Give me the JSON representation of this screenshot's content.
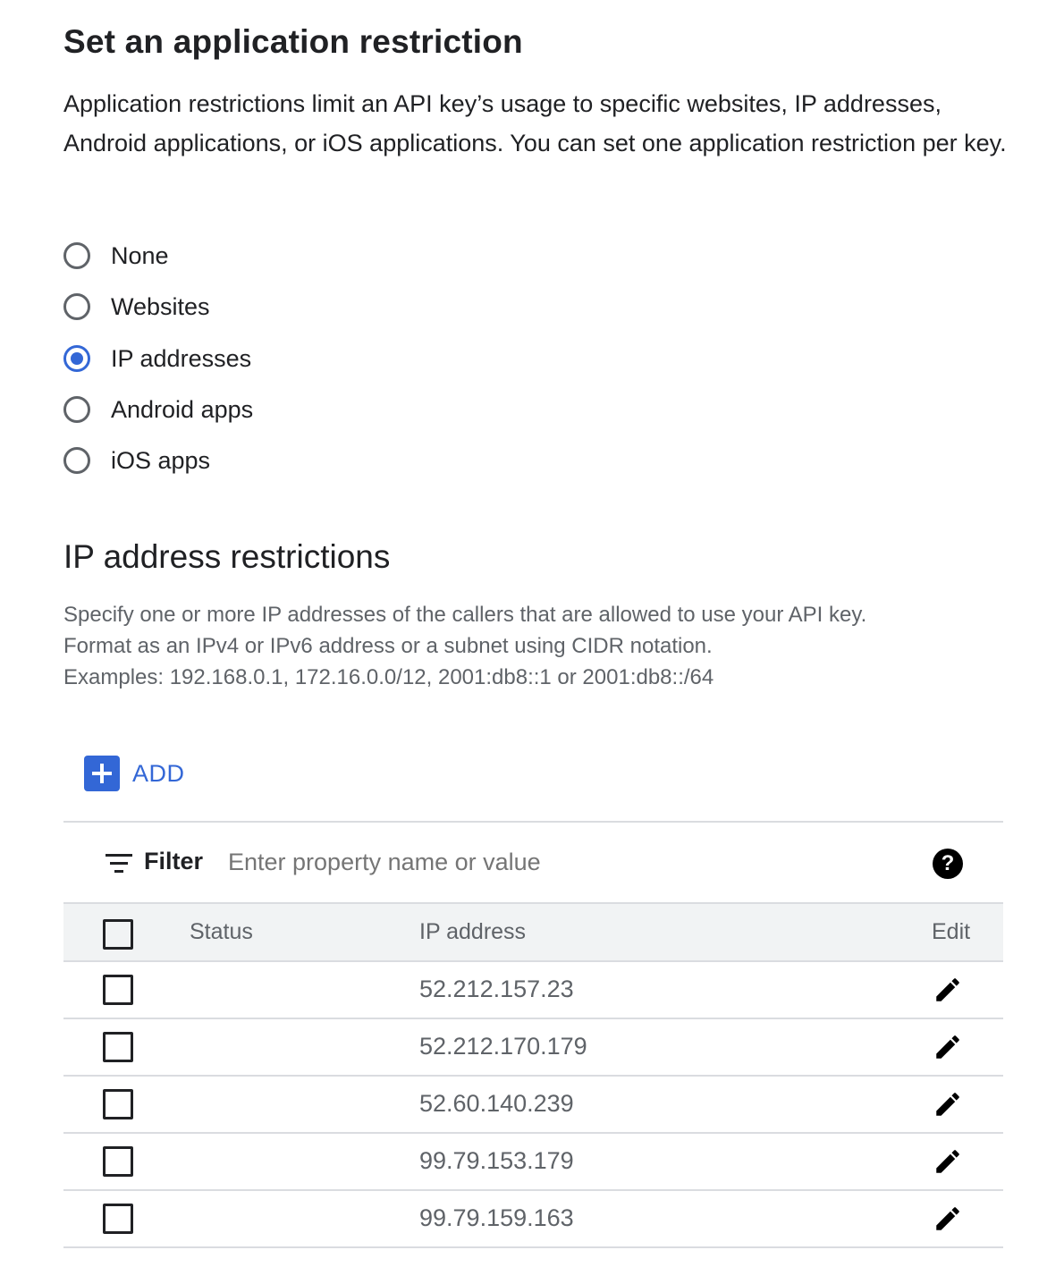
{
  "restriction": {
    "title": "Set an application restriction",
    "description": "Application restrictions limit an API key’s usage to specific websites, IP addresses, Android applications, or iOS applications. You can set one application restriction per key.",
    "options": [
      {
        "label": "None",
        "selected": false
      },
      {
        "label": "Websites",
        "selected": false
      },
      {
        "label": "IP addresses",
        "selected": true
      },
      {
        "label": "Android apps",
        "selected": false
      },
      {
        "label": "iOS apps",
        "selected": false
      }
    ]
  },
  "ip_restrictions": {
    "title": "IP address restrictions",
    "help_lines": [
      "Specify one or more IP addresses of the callers that are allowed to use your API key.",
      "Format as an IPv4 or IPv6 address or a subnet using CIDR notation.",
      "Examples: 192.168.0.1, 172.16.0.0/12, 2001:db8::1 or 2001:db8::/64"
    ],
    "add_label": "ADD",
    "filter": {
      "label": "Filter",
      "placeholder": "Enter property name or value",
      "help_glyph": "?"
    },
    "columns": {
      "status": "Status",
      "ip": "IP address",
      "edit": "Edit"
    },
    "rows": [
      {
        "status": "",
        "ip": "52.212.157.23"
      },
      {
        "status": "",
        "ip": "52.212.170.179"
      },
      {
        "status": "",
        "ip": "52.60.140.239"
      },
      {
        "status": "",
        "ip": "99.79.153.179"
      },
      {
        "status": "",
        "ip": "99.79.159.163"
      }
    ]
  },
  "colors": {
    "accent": "#3367d6",
    "text": "#202124",
    "secondary_text": "#5f6368",
    "divider": "#dadce0",
    "header_bg": "#f1f3f4"
  }
}
